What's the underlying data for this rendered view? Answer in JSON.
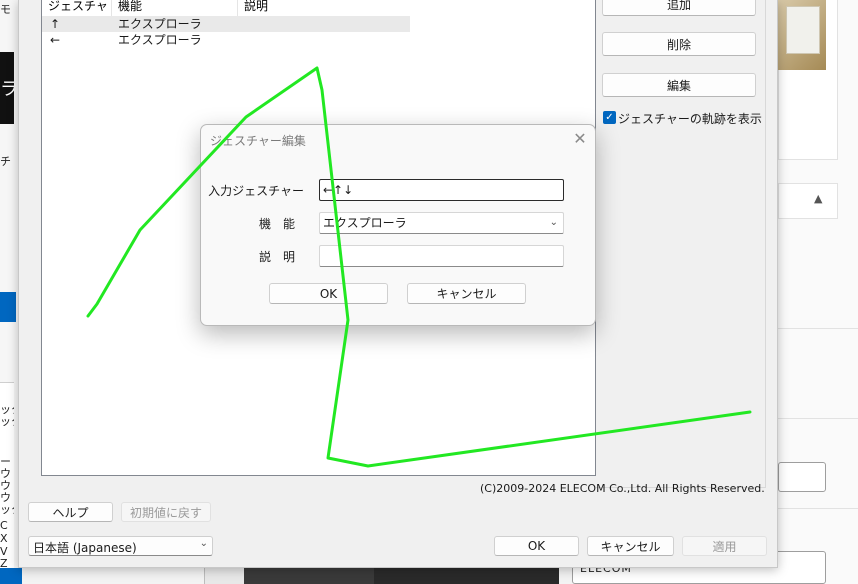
{
  "background": {
    "left_labels": [
      "モ",
      "ラ",
      "チ",
      "ック",
      "ック",
      "ー",
      "ウ",
      "ウ",
      "ウ",
      "ック",
      "C",
      "X",
      "V",
      "Z"
    ],
    "right_field_value": "ELECOM"
  },
  "gesture_list": {
    "columns": [
      "ジェスチャー",
      "機能",
      "説明"
    ],
    "rows": [
      {
        "gesture": "↑",
        "function": "エクスプローラ",
        "description": ""
      },
      {
        "gesture": "←",
        "function": "エクスプローラ",
        "description": ""
      }
    ]
  },
  "side_buttons": {
    "add": "追加",
    "delete": "削除",
    "edit": "編集",
    "show_trail_label": "ジェスチャーの軌跡を表示",
    "show_trail_checked": true
  },
  "copyright": "(C)2009-2024 ELECOM Co.,Ltd. All Rights Reserved.",
  "footer": {
    "help": "ヘルプ",
    "reset_defaults": "初期値に戻す",
    "language": "日本語 (Japanese)",
    "ok": "OK",
    "cancel": "キャンセル",
    "apply": "適用"
  },
  "dialog": {
    "title": "ジェスチャー編集",
    "input_gesture_label": "入力ジェスチャー",
    "input_gesture_value": "←↑↓",
    "function_label": "機　能",
    "function_value": "エクスプローラ",
    "description_label": "説　明",
    "description_value": "",
    "ok": "OK",
    "cancel": "キャンセル"
  },
  "colors": {
    "accent": "#0067c0",
    "gesture_trail": "#22e822"
  },
  "icons": {
    "close": "close-icon",
    "dropdown": "chevron-down-icon",
    "check": "checkmark-icon",
    "collapse": "chevron-up-icon"
  }
}
